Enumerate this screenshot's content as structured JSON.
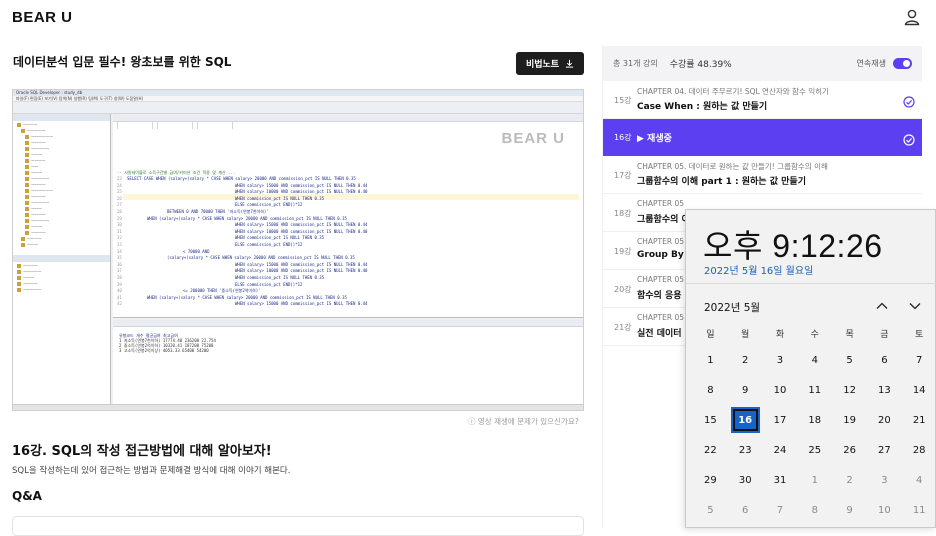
{
  "header": {
    "logo": "BEAR U",
    "user_icon": "user-icon"
  },
  "course": {
    "title": "데이터분석 입문 필수! 왕초보를 위한 SQL",
    "note_button": "비법노트"
  },
  "video": {
    "app_title": "Oracle SQL Developer : study_db",
    "menu": "파일(F)  편집(E)  보기(V)  탐색(N)  실행(R)  팀(M)  도구(T)  창(W)  도움말(H)",
    "watermark": "BEAR U",
    "comment_line": "-- 사원테이블로 소득구간별 급여/커미션 조건 적용 및 계산 ...",
    "code_lines": [
      "SELECT CASE WHEN (salary+(salary * CASE WHEN salary> 20000 AND commission_pct IS NULL THEN 0.35",
      "WHEN salary> 15000 AND commission_pct IS NULL THEN 0.44",
      "WHEN salary> 10000 AND commission_pct IS NULL THEN 0.40",
      "WHEN commission_pct IS NULL THEN 0.35",
      "ELSE commission_pct  END))*12",
      "BETWEEN 0 AND 70000 THEN '저소득(연봉7천이하)'",
      "WHEN (salary+(salary * CASE WHEN salary> 20000 AND commission_pct IS NULL THEN 0.35",
      "WHEN salary> 15000 AND commission_pct IS NULL THEN 0.44",
      "WHEN salary> 10000 AND commission_pct IS NULL THEN 0.40",
      "WHEN commission_pct IS NULL THEN 0.35",
      "ELSE commission_pct  END))*12",
      "< 70000 AND",
      "(salary+(salary * CASE WHEN salary> 20000 AND commission_pct IS NULL THEN 0.35",
      "WHEN salary> 15000 AND commission_pct IS NULL THEN 0.44",
      "WHEN salary> 10000 AND commission_pct IS NULL THEN 0.40",
      "WHEN commission_pct IS NULL THEN 0.35",
      "ELSE commission_pct  END))*12",
      "<= 200000 THEN '중소득(연봉2억이하)'",
      "WHEN (salary+(salary * CASE WHEN salary> 20000 AND commission_pct IS NULL THEN 0.35",
      "WHEN salary> 15000 AND commission_pct IS NULL THEN 0.44"
    ],
    "result_rows": [
      "1 저소득(연봉7천이하)   17774.48  236200  22.754",
      "2 중소득(연봉2억이하)   10320.41  187200  75200",
      "3 고소득(연봉2억이상)    4053.33   65400  54200"
    ]
  },
  "report_link": "영상 재생에 문제가 있으신가요?",
  "lesson": {
    "title": "16강. SQL의 작성 접근방법에 대해 알아보자!",
    "description": "SQL을 작성하는데 있어 접근하는 방법과 문제해결 방식에 대해 이야기 해본다."
  },
  "qa_title": "Q&A",
  "panel": {
    "total": "총 31개 강의",
    "progress": "수강률 48.39%",
    "continuous_label": "연속재생",
    "continuous_on": true,
    "accent": "#5b3ff0",
    "items": [
      {
        "num": "15강",
        "chapter": "CHAPTER 04. 데이터 주무르기! SQL 연산자와 함수 익히기",
        "title": "Case When : 원하는 값 만들기",
        "done": true
      },
      {
        "num": "16강",
        "playing": "▶  재생중",
        "active": true,
        "done": true
      },
      {
        "num": "17강",
        "chapter": "CHAPTER 05. 데이터로 원하는 값 만들기! 그룹함수의 이해",
        "title": "그룹함수의 이해 part 1 : 원하는 값 만들기"
      },
      {
        "num": "18강",
        "chapter": "CHAPTER 05",
        "title": "그룹함수의 이"
      },
      {
        "num": "19강",
        "chapter": "CHAPTER 05",
        "title": "Group By /"
      },
      {
        "num": "20강",
        "chapter": "CHAPTER 05",
        "title": "함수의 응용"
      },
      {
        "num": "21강",
        "chapter": "CHAPTER 05",
        "title": "실전 데이터"
      }
    ]
  },
  "clock": {
    "time": "오후 9:12:26",
    "date": "2022년 5월 16일 월요일",
    "month": "2022년 5월",
    "weekdays": [
      "일",
      "월",
      "화",
      "수",
      "목",
      "금",
      "토"
    ],
    "weeks": [
      [
        "1",
        "2",
        "3",
        "4",
        "5",
        "6",
        "7"
      ],
      [
        "8",
        "9",
        "10",
        "11",
        "12",
        "13",
        "14"
      ],
      [
        "15",
        "16",
        "17",
        "18",
        "19",
        "20",
        "21"
      ],
      [
        "22",
        "23",
        "24",
        "25",
        "26",
        "27",
        "28"
      ],
      [
        "29",
        "30",
        "31",
        "1",
        "2",
        "3",
        "4"
      ],
      [
        "5",
        "6",
        "7",
        "8",
        "9",
        "10",
        "11"
      ]
    ],
    "today": "16"
  }
}
